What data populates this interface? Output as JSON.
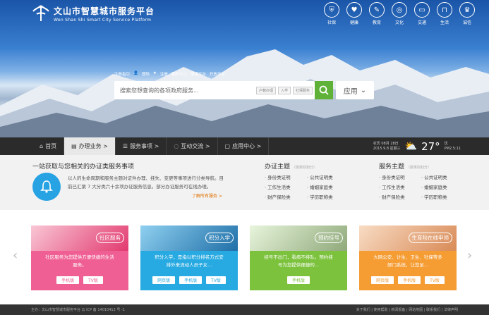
{
  "header": {
    "title": "文山市智慧城市服务平台",
    "subtitle": "Wen Shan Shi Smart City Service Platform",
    "topnav": [
      {
        "label": "社保",
        "icon": "shield-icon"
      },
      {
        "label": "健康",
        "icon": "heart-icon"
      },
      {
        "label": "教育",
        "icon": "book-icon"
      },
      {
        "label": "文化",
        "icon": "globe-icon"
      },
      {
        "label": "交通",
        "icon": "car-icon"
      },
      {
        "label": "生活",
        "icon": "bag-icon"
      },
      {
        "label": "诚信",
        "icon": "trophy-icon"
      }
    ]
  },
  "userbar": [
    "注册指引",
    "登陆",
    "注册",
    "我的文山",
    "便捷平台",
    "开放平台"
  ],
  "search": {
    "placeholder": "搜索您想查询的各项政府服务...",
    "tags": [
      "户籍办理",
      "入学",
      "社保服务"
    ],
    "app_label": "应用"
  },
  "nav": {
    "items": [
      {
        "label": "首页",
        "icon": "home-icon"
      },
      {
        "label": "办理业务 >",
        "icon": "doc-icon"
      },
      {
        "label": "服务事项 >",
        "icon": "list-icon"
      },
      {
        "label": "互动交流 >",
        "icon": "chat-icon"
      },
      {
        "label": "应用中心 >",
        "icon": "app-icon"
      }
    ],
    "date1": "农历 08月 28日",
    "date2": "2015.9.8 星期三",
    "temp": "27°",
    "pm_label": "优",
    "pm_value": "PM2.5:11"
  },
  "services": {
    "title": "一站获取与您相关的办证类服务事项",
    "desc": "以人的生命周期和服务主题对证件办理、挂失、变更等事项进行分类导航。目前已汇聚 7 大分类六十余项办证服务信息。部分办证服务可在线办理。",
    "more": "了解所有服务 >",
    "theme1": {
      "title": "办证主题",
      "sub": "（按类别划分）",
      "items": [
        "· 身份类证明",
        "· 公共证明类",
        "· 工作生活类",
        "· 婚姻家庭类",
        "· 财产保险类",
        "· 学历职称类"
      ]
    },
    "theme2": {
      "title": "服务主题",
      "sub": "（按类别划分）",
      "items": [
        "· 身份类证明",
        "· 公共证明类",
        "· 工作生活类",
        "· 婚姻家庭类",
        "· 财产保险类",
        "· 学历职称类"
      ]
    }
  },
  "cards": [
    {
      "label": "社区服务",
      "text": "社区服务为您提供方便快捷的生活服务。",
      "buttons": [
        "手机版",
        "TV版"
      ],
      "color": "#ef5f93"
    },
    {
      "label": "积分入学",
      "text": "积分入学，是指以积分排名方式安排外来流动人员子女...",
      "buttons": [
        "网页版",
        "手机版",
        "TV版"
      ],
      "color": "#27a9e1"
    },
    {
      "label": "预约挂号",
      "text": "挂号不出门，看病不排队。预约挂号为您提供便捷的...",
      "buttons": [
        "手机版"
      ],
      "color": "#7cc23d"
    },
    {
      "label": "生育险在线申领",
      "text": "大网公安、计生、卫生、社保等多部门系统，让您足...",
      "buttons": [
        "网页版",
        "手机版",
        "TV版"
      ],
      "color": "#f59c33"
    }
  ],
  "footer": {
    "left": "主办：文山市智慧城市服务平台   云 ICP 备 14010412 号 -1",
    "right": "关于我们 | 使用帮助 | 新闻报备 | 网站地图 | 联系我们 | 法律声明"
  }
}
